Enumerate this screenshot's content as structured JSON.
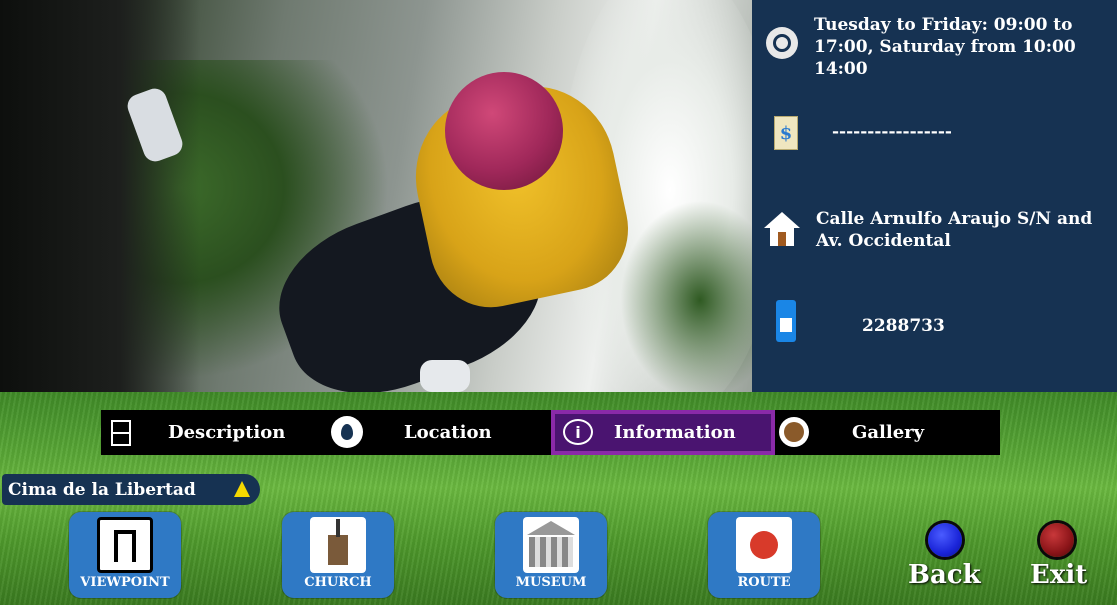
{
  "info_panel": {
    "hours": "Tuesday to Friday: 09:00 to 17:00, Saturday from 10:00 14:00",
    "price": "-----------------",
    "address": "Calle Arnulfo Araujo S/N and Av. Occidental",
    "phone": "2288733",
    "icons": [
      "clock-icon",
      "dollar-icon",
      "house-icon",
      "phone-icon"
    ]
  },
  "tabs": [
    {
      "label": "Description",
      "icon": "document-icon"
    },
    {
      "label": "Location",
      "icon": "location-pin-icon"
    },
    {
      "label": "Information",
      "icon": "info-icon",
      "selected": true
    },
    {
      "label": "Gallery",
      "icon": "gallery-icon"
    }
  ],
  "place": {
    "name": "Cima de la Libertad"
  },
  "nav_buttons": [
    {
      "label": "VIEWPOINT",
      "icon": "viewpoint-icon"
    },
    {
      "label": "CHURCH",
      "icon": "church-icon"
    },
    {
      "label": "MUSEUM",
      "icon": "museum-icon"
    },
    {
      "label": "ROUTE",
      "icon": "route-icon"
    }
  ],
  "actions": {
    "back": "Back",
    "exit": "Exit"
  },
  "colors": {
    "panel": "#163252",
    "selected_tab": "#4a1470",
    "selected_border": "#8a2aa8",
    "button": "#2f79c5",
    "back": "#1a24d8",
    "exit": "#8a1418"
  }
}
